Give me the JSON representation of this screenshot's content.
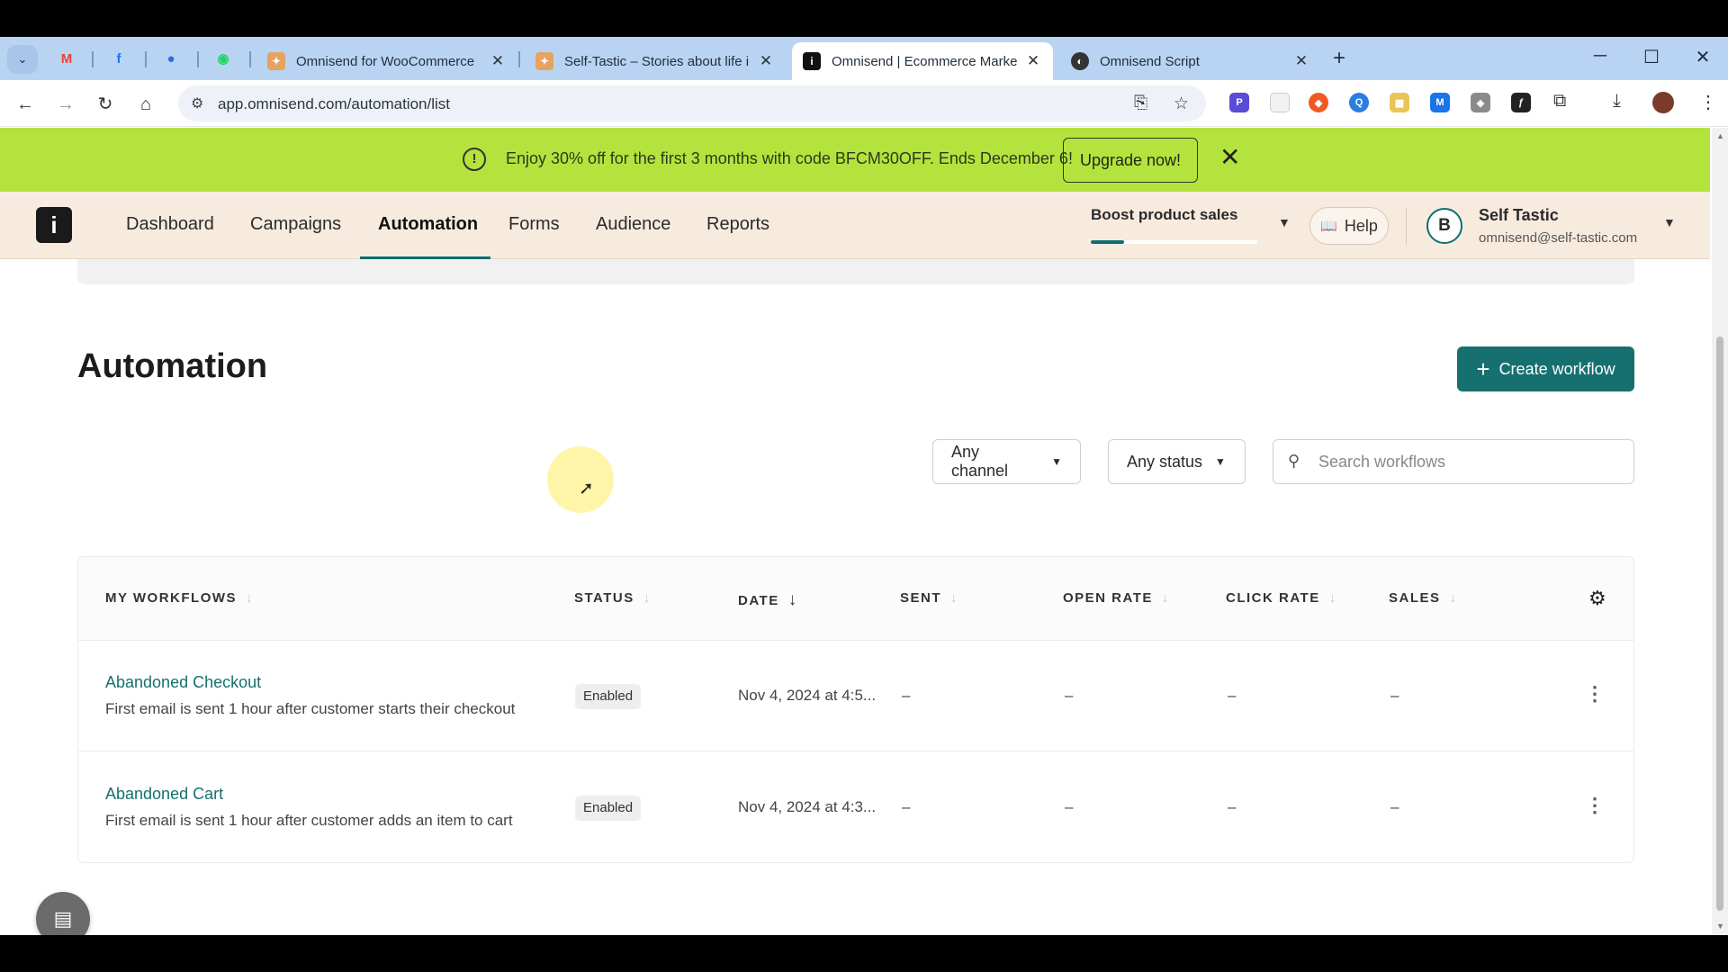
{
  "browser": {
    "pinned_tabs": [
      {
        "icon": "gmail-icon",
        "glyph": "M",
        "color": "#ea4335"
      },
      {
        "icon": "facebook-icon",
        "glyph": "f",
        "color": "#1877f2"
      },
      {
        "icon": "messenger-icon",
        "glyph": "●",
        "color": "#2d6cdf"
      },
      {
        "icon": "whatsapp-icon",
        "glyph": "◉",
        "color": "#25d366"
      }
    ],
    "tabs": [
      {
        "title": "Omnisend for WooCommerce",
        "active": false,
        "fav_color": "#e7a25d"
      },
      {
        "title": "Self-Tastic – Stories about life in",
        "active": false,
        "fav_color": "#e7a25d"
      },
      {
        "title": "Omnisend | Ecommerce Market",
        "active": true,
        "fav_color": "#111111"
      },
      {
        "title": "Omnisend Script",
        "active": false,
        "fav_color": "#333333"
      }
    ],
    "url": "app.omnisend.com/automation/list"
  },
  "promo": {
    "message": "Enjoy 30% off for the first 3 months with code BFCM30OFF. Ends December 6!",
    "upgrade_label": "Upgrade now!"
  },
  "nav": {
    "items": [
      "Dashboard",
      "Campaigns",
      "Automation",
      "Forms",
      "Audience",
      "Reports"
    ],
    "active": "Automation",
    "boost_label": "Boost product sales",
    "boost_progress": 0.2,
    "help_label": "Help",
    "user": {
      "initial": "B",
      "name": "Self Tastic",
      "email": "omnisend@self-tastic.com"
    }
  },
  "page": {
    "title": "Automation",
    "create_label": "Create workflow",
    "filters": {
      "channel": "Any channel",
      "status": "Any status"
    },
    "search_placeholder": "Search workflows"
  },
  "table": {
    "columns": [
      "MY WORKFLOWS",
      "STATUS",
      "DATE",
      "SENT",
      "OPEN RATE",
      "CLICK RATE",
      "SALES"
    ],
    "rows": [
      {
        "name": "Abandoned Checkout",
        "description": "First email is sent 1 hour after customer starts their checkout",
        "status": "Enabled",
        "date": "Nov 4, 2024 at 4:5...",
        "sent": "–",
        "open_rate": "–",
        "click_rate": "–",
        "sales": "–"
      },
      {
        "name": "Abandoned Cart",
        "description": "First email is sent 1 hour after customer adds an item to cart",
        "status": "Enabled",
        "date": "Nov 4, 2024 at 4:3...",
        "sent": "–",
        "open_rate": "–",
        "click_rate": "–",
        "sales": "–"
      }
    ]
  },
  "colors": {
    "accent": "#16706f",
    "promo_bg": "#b5e33e",
    "nav_bg": "#f7ebde"
  }
}
